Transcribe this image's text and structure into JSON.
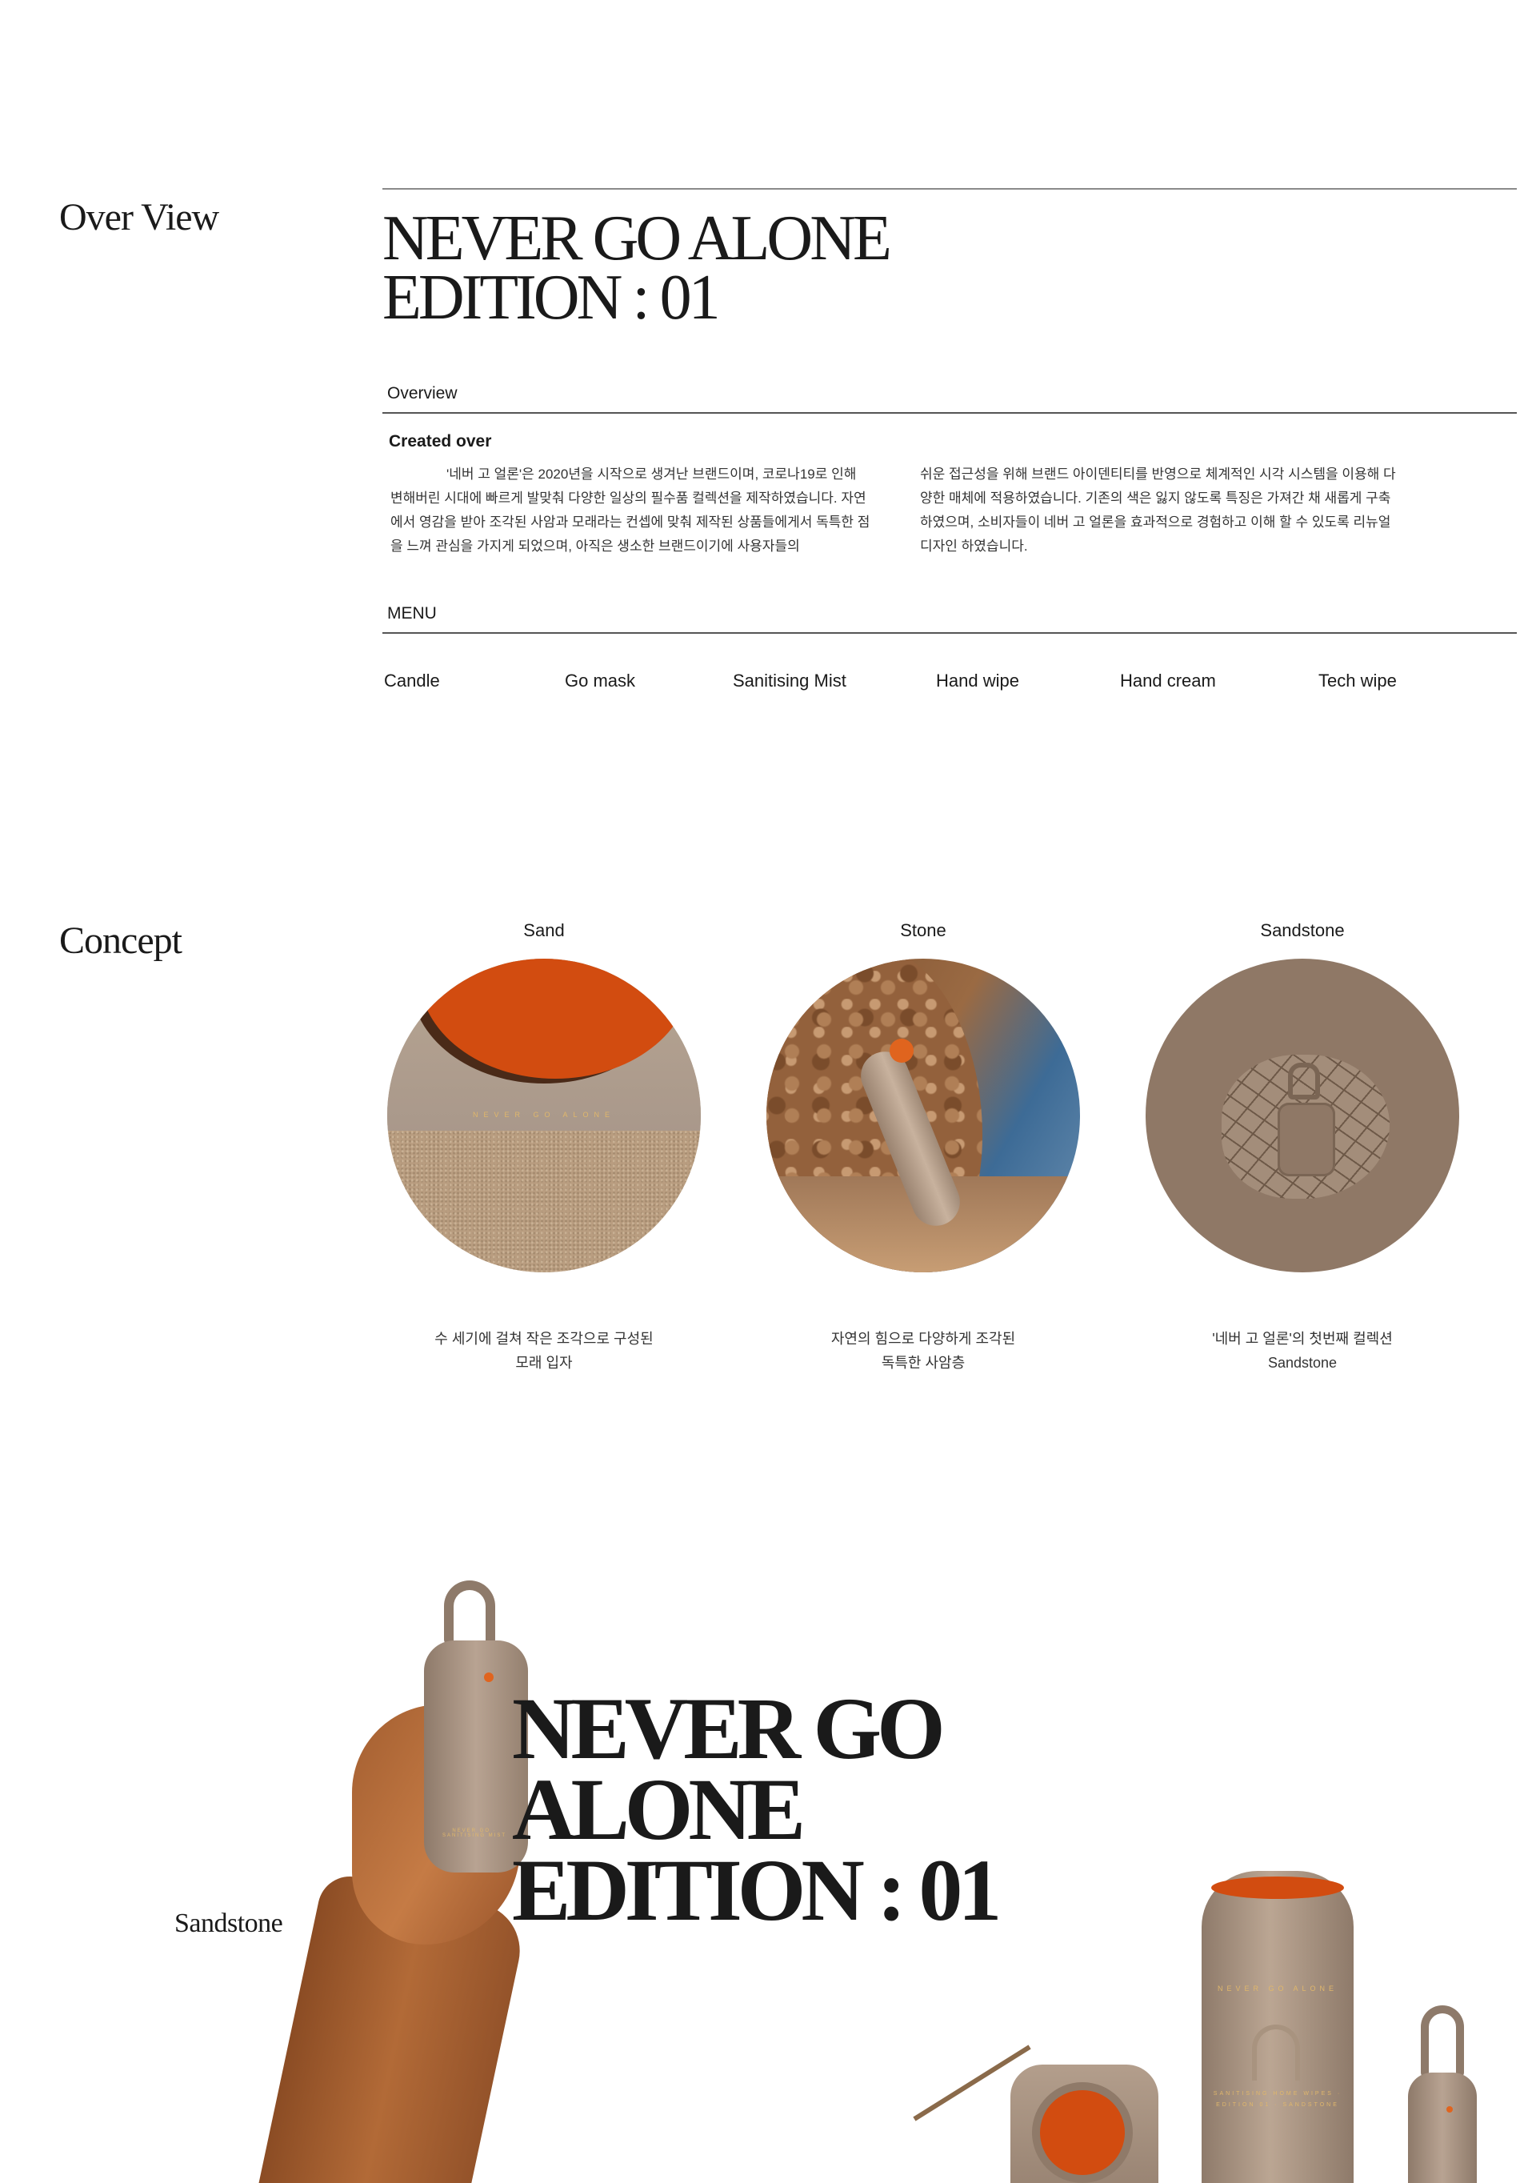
{
  "overview": {
    "heading": "Over View",
    "title_line1": "NEVER GO ALONE",
    "title_line2": "EDITION : 01",
    "overview_label": "Overview",
    "created_over": "Created over",
    "para_left": "'네버 고 얼론'은 2020년을 시작으로 생겨난 브랜드이며, 코로나19로 인해 변해버린 시대에 빠르게 발맞춰 다양한 일상의 필수품 컬렉션을 제작하였습니다. 자연에서 영감을 받아 조각된 사암과 모래라는 컨셉에 맞춰 제작된 상품들에게서 독특한 점을 느껴 관심을 가지게 되었으며, 아직은 생소한 브랜드이기에 사용자들의",
    "para_right": "쉬운 접근성을 위해 브랜드 아이덴티티를 반영으로 체계적인 시각 시스템을 이용해 다양한 매체에 적용하였습니다. 기존의 색은 잃지 않도록 특징은 가져간 채 새롭게 구축하였으며, 소비자들이 네버 고 얼론을 효과적으로 경험하고 이해 할 수 있도록 리뉴얼 디자인 하였습니다.",
    "menu_label": "MENU",
    "menu": [
      "Candle",
      "Go mask",
      "Sanitising Mist",
      "Hand wipe",
      "Hand cream",
      "Tech wipe"
    ]
  },
  "concept": {
    "heading": "Concept",
    "columns": [
      {
        "title": "Sand",
        "caption_l1": "수 세기에 걸쳐 작은 조각으로 구성된",
        "caption_l2": "모래 입자",
        "label": "NEVER GO ALONE"
      },
      {
        "title": "Stone",
        "caption_l1": "자연의 힘으로 다양하게 조각된",
        "caption_l2": "독특한 사암층"
      },
      {
        "title": "Sandstone",
        "caption_l1": "'네버 고 얼론'의 첫번째 컬렉션",
        "caption_l2": "Sandstone"
      }
    ]
  },
  "hero": {
    "label": "Sandstone",
    "title_line1": "NEVER GO",
    "title_line2": "ALONE",
    "title_line3": "EDITION : 01",
    "bottle_text": "NEVER GO · SANITISING MIST",
    "tube_text": "NEVER GO ALONE",
    "tube_sub": "SANITISING HOME WIPES · EDITION 01 · SANDSTONE"
  },
  "colors": {
    "accent_orange": "#d24c10",
    "sand": "#b39e8c",
    "text": "#1a1a1a"
  }
}
